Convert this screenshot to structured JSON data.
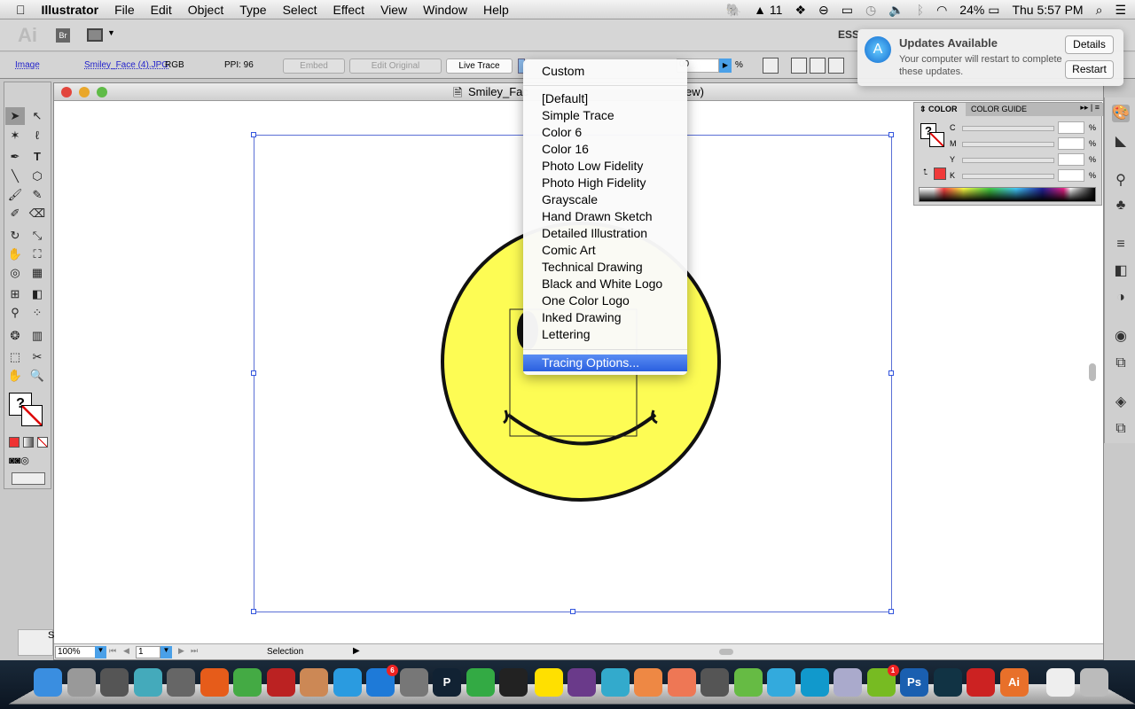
{
  "menubar": {
    "app": "Illustrator",
    "items": [
      "File",
      "Edit",
      "Object",
      "Type",
      "Select",
      "Effect",
      "View",
      "Window",
      "Help"
    ],
    "status": {
      "adobe_count": "11",
      "battery": "24%",
      "clock": "Thu 5:57 PM"
    }
  },
  "appbar": {
    "logo": "Ai",
    "bridge": "Br",
    "workspace": "ESS"
  },
  "control": {
    "type_link": "Image",
    "file_link": "Smiley_Face (4).JPG",
    "mode": "RGB",
    "ppi": "PPI: 96",
    "embed": "Embed",
    "edit_original": "Edit Original",
    "live_trace": "Live Trace",
    "opacity_value": "00",
    "percent": "%"
  },
  "document": {
    "title_left": "Smiley_Fac",
    "title_right": "ew)",
    "zoom": "100%",
    "page": "1",
    "status_tool": "Selection",
    "tab_letter": "S"
  },
  "trace_menu": {
    "items": [
      "Custom",
      "[Default]",
      "Simple Trace",
      "Color 6",
      "Color 16",
      "Photo Low Fidelity",
      "Photo High Fidelity",
      "Grayscale",
      "Hand Drawn Sketch",
      "Detailed Illustration",
      "Comic Art",
      "Technical Drawing",
      "Black and White Logo",
      "One Color Logo",
      "Inked Drawing",
      "Lettering"
    ],
    "selected": "Tracing Options..."
  },
  "notification": {
    "title": "Updates Available",
    "body": "Your computer will restart to complete these updates.",
    "details": "Details",
    "restart": "Restart"
  },
  "color_panel": {
    "tab1": "COLOR",
    "tab2": "COLOR GUIDE",
    "channels": [
      "C",
      "M",
      "Y",
      "K"
    ],
    "unit": "%",
    "fill_color": "#f03a3a"
  },
  "colors": {
    "smiley": "#fdfc54",
    "selection": "#3355dd",
    "menu_highlight": "#2f64e3"
  },
  "dock": {
    "appstore_badge": "6",
    "spotify_badge": "1",
    "apps": [
      "finder",
      "launchpad",
      "mission-control",
      "safari",
      "facetime",
      "firefox",
      "chrome",
      "photo-booth",
      "iphoto",
      "itunes",
      "app-store",
      "system-preferences",
      "pixelmator",
      "evernote",
      "terminal",
      "replicatorg",
      "visual-studio",
      "messenger",
      "scratch",
      "powerpoint",
      "window",
      "excel",
      "word",
      "network",
      "preview",
      "spotify",
      "photoshop",
      "mw",
      "mw2",
      "illustrator"
    ]
  }
}
